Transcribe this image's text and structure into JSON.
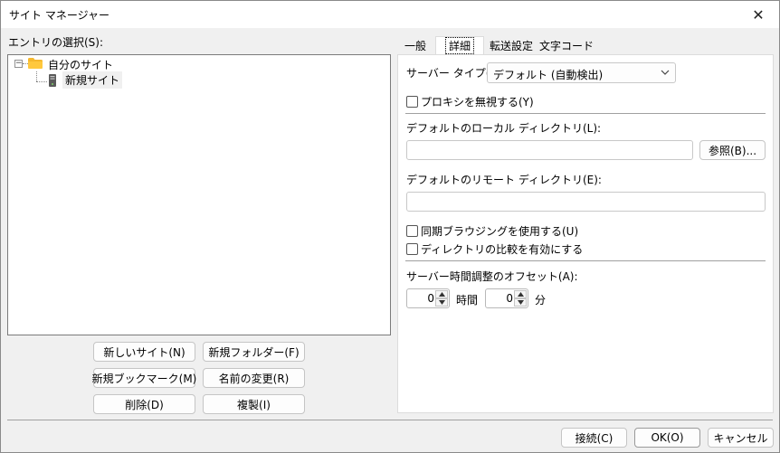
{
  "window": {
    "title": "サイト マネージャー",
    "close_glyph": "✕"
  },
  "entries": {
    "label": "エントリの選択(S):",
    "expander_glyph": "−",
    "folder_name": "自分のサイト",
    "site_name": "新規サイト"
  },
  "left_buttons": {
    "new_site": "新しいサイト(N)",
    "new_folder": "新規フォルダー(F)",
    "new_bookmark": "新規ブックマーク(M)",
    "rename": "名前の変更(R)",
    "delete": "削除(D)",
    "duplicate": "複製(I)"
  },
  "tabs": {
    "general": "一般",
    "advanced": "詳細",
    "transfer": "転送設定",
    "charset": "文字コード"
  },
  "advanced": {
    "server_type_label": "サーバー タイプ(T):",
    "server_type_value": "デフォルト (自動検出)",
    "bypass_proxy_label": "プロキシを無視する(Y)",
    "local_dir_label": "デフォルトのローカル ディレクトリ(L):",
    "local_dir_value": "",
    "browse_button": "参照(B)...",
    "remote_dir_label": "デフォルトのリモート ディレクトリ(E):",
    "remote_dir_value": "",
    "sync_browsing_label": "同期ブラウジングを使用する(U)",
    "dir_compare_label": "ディレクトリの比較を有効にする",
    "offset_label": "サーバー時間調整のオフセット(A):",
    "hours_value": "0",
    "hours_unit": "時間",
    "minutes_value": "0",
    "minutes_unit": "分"
  },
  "footer": {
    "connect": "接続(C)",
    "ok": "OK(O)",
    "cancel": "キャンセル"
  }
}
